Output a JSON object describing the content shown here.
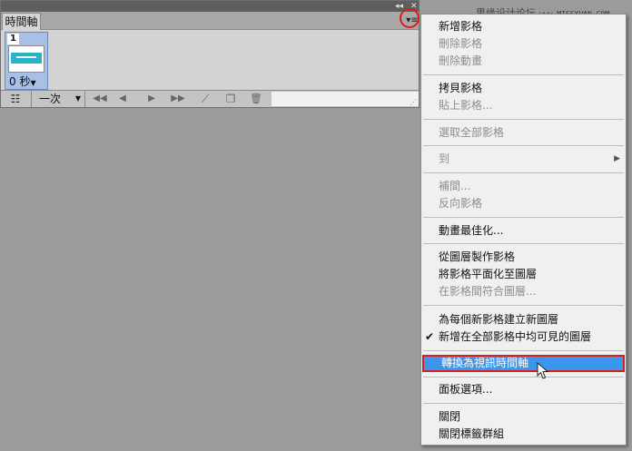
{
  "watermark": {
    "text": "思缘设计论坛",
    "url": "www.MISSYUAN.COM"
  },
  "panel": {
    "collapse_glyph": "◂◂",
    "close_glyph": "✕",
    "tab_label": "時間軸",
    "menu_icon": "▾≡",
    "frame": {
      "number": "1",
      "delay": "0 秒",
      "delay_caret": "▼"
    },
    "controls": {
      "convert_icon": "☷",
      "loop_value": "一次",
      "loop_caret": "▼",
      "first_frame": "◀◀",
      "prev_frame": "◀",
      "play": "▶",
      "next_frame": "▶▶",
      "tween_icon": "⟋",
      "new_frame_icon": "❐",
      "delete_icon": "🗑"
    }
  },
  "menu": {
    "items": [
      {
        "label": "新增影格",
        "enabled": true
      },
      {
        "label": "刪除影格",
        "enabled": false
      },
      {
        "label": "刪除動畫",
        "enabled": false
      },
      {
        "label": "拷貝影格",
        "enabled": true
      },
      {
        "label": "貼上影格...",
        "enabled": false
      },
      {
        "label": "選取全部影格",
        "enabled": false
      },
      {
        "label": "到",
        "enabled": false,
        "submenu_arrow": "▶"
      },
      {
        "label": "補間...",
        "enabled": false
      },
      {
        "label": "反向影格",
        "enabled": false
      },
      {
        "label": "動畫最佳化...",
        "enabled": true
      },
      {
        "label": "從圖層製作影格",
        "enabled": true
      },
      {
        "label": "將影格平面化至圖層",
        "enabled": true
      },
      {
        "label": "在影格間符合圖層...",
        "enabled": false
      },
      {
        "label": "為每個新影格建立新圖層",
        "enabled": true
      },
      {
        "label": "新增在全部影格中均可見的圖層",
        "enabled": true,
        "checked": true,
        "check_glyph": "✔"
      },
      {
        "label": "轉換為視訊時間軸",
        "enabled": true,
        "highlighted": true
      },
      {
        "label": "面板選項...",
        "enabled": true
      },
      {
        "label": "關閉",
        "enabled": true
      },
      {
        "label": "關閉標籤群組",
        "enabled": true
      }
    ]
  },
  "colors": {
    "highlight": "#3c96ee",
    "annotation_red": "#e01b1b",
    "frame_selected": "#a8bfe6",
    "thumb_band": "#28b3c8"
  }
}
